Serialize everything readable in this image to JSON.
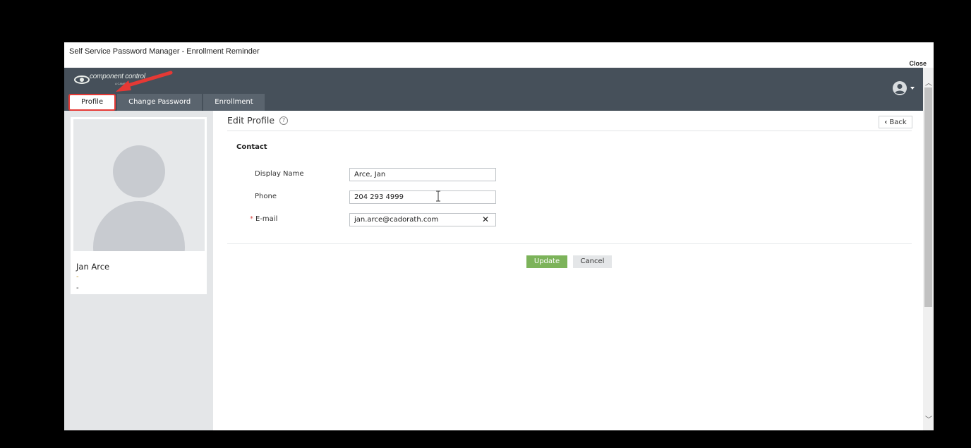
{
  "window": {
    "title": "Self Service Password Manager - Enrollment Reminder",
    "close_label": "Close"
  },
  "header": {
    "logo_text": "component control",
    "logo_sub": "A CAMP",
    "tabs": [
      {
        "label": "Profile",
        "active": true
      },
      {
        "label": "Change Password",
        "active": false
      },
      {
        "label": "Enrollment",
        "active": false
      }
    ],
    "user_icon": "user-circle-icon"
  },
  "sidebar": {
    "user_name": "Jan Arce",
    "line1": "-",
    "line2": "-"
  },
  "main": {
    "title": "Edit Profile",
    "help_icon": "question-circle-icon",
    "back_label": "Back",
    "section_label": "Contact",
    "fields": [
      {
        "label": "Display Name",
        "value": "Arce, Jan",
        "required": false
      },
      {
        "label": "Phone",
        "value": "204 293 4999",
        "required": false
      },
      {
        "label": "E-mail",
        "value": "jan.arce@cadorath.com",
        "required": true
      }
    ],
    "required_marker": "*",
    "update_label": "Update",
    "cancel_label": "Cancel"
  },
  "colors": {
    "header_bg": "#46505a",
    "tab_bg": "#5a646e",
    "update_bg": "#7cb35a",
    "highlight": "#e53935"
  }
}
